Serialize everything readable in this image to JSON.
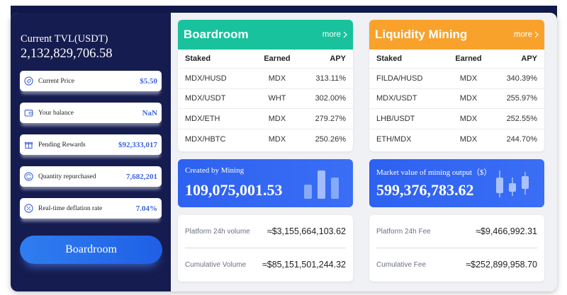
{
  "tvl": {
    "label": "Current TVL(USDT)",
    "value": "2,132,829,706.58"
  },
  "stats": [
    {
      "label": "Current Price",
      "value": "$5.50",
      "icon": "price-tag-icon"
    },
    {
      "label": "Your balance",
      "value": "NaN",
      "icon": "wallet-icon"
    },
    {
      "label": "Pending Rewards",
      "value": "$92,333,017",
      "icon": "gift-icon"
    },
    {
      "label": "Quantity repurchased",
      "value": "7,682,201",
      "icon": "repurchase-icon"
    },
    {
      "label": "Real-time deflation rate",
      "value": "7.04%",
      "icon": "percent-icon"
    }
  ],
  "left_button": "Boardroom",
  "boardroom": {
    "title": "Boardroom",
    "more": "more",
    "accent": "#18c29c",
    "columns": [
      "Staked",
      "Earned",
      "APY"
    ],
    "rows": [
      [
        "MDX/HUSD",
        "MDX",
        "313.11%"
      ],
      [
        "MDX/USDT",
        "WHT",
        "302.00%"
      ],
      [
        "MDX/ETH",
        "MDX",
        "279.27%"
      ],
      [
        "MDX/HBTC",
        "MDX",
        "250.26%"
      ]
    ]
  },
  "liquidity": {
    "title": "Liquidity Mining",
    "more": "more",
    "accent": "#f8a22c",
    "columns": [
      "Staked",
      "Earned",
      "APY"
    ],
    "rows": [
      [
        "FILDA/HUSD",
        "MDX",
        "340.39%"
      ],
      [
        "MDX/USDT",
        "MDX",
        "255.97%"
      ],
      [
        "LHB/USDT",
        "MDX",
        "252.55%"
      ],
      [
        "ETH/MDX",
        "MDX",
        "244.70%"
      ]
    ]
  },
  "mining": {
    "caption": "Created by Mining",
    "value": "109,075,001.53"
  },
  "market": {
    "caption": "Market value of mining output（$）",
    "value": "599,376,783.62"
  },
  "volume": {
    "platform_label": "Platform 24h volume",
    "platform_value": "≈$3,155,664,103.62",
    "cumulative_label": "Cumulative Volume",
    "cumulative_value": "≈$85,151,501,244.32"
  },
  "fee": {
    "platform_label": "Platform 24h Fee",
    "platform_value": "≈$9,466,992.31",
    "cumulative_label": "Cumulative Fee",
    "cumulative_value": "≈$252,899,958.70"
  },
  "colors": {
    "navy": "#151c4f",
    "blue": "#2d61f0",
    "value_blue": "#3d63e0"
  }
}
